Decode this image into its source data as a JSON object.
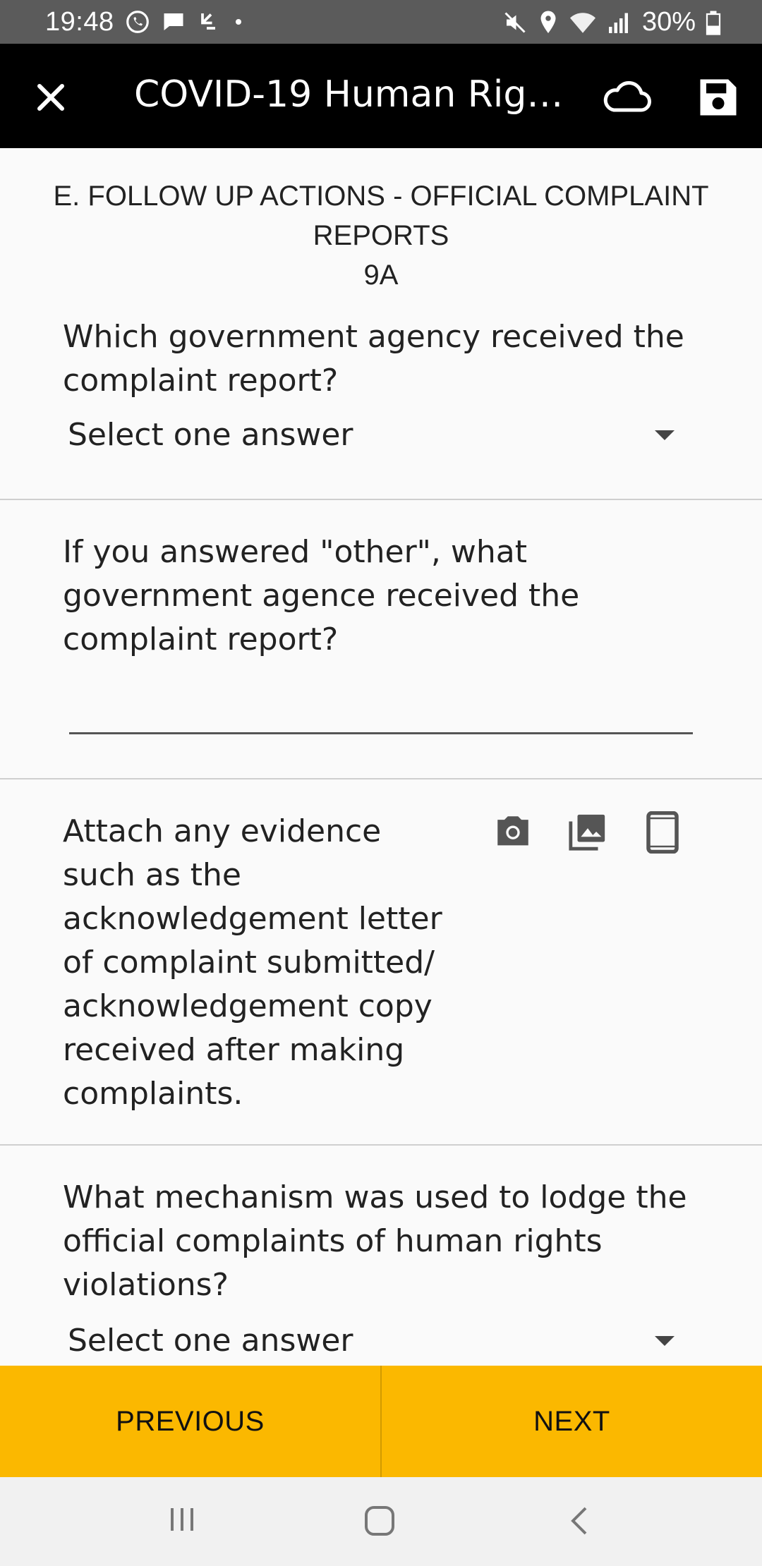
{
  "status_bar": {
    "time": "19:48",
    "battery": "30%",
    "left_icons": [
      "whatsapp-icon",
      "message-icon",
      "missed-call-icon",
      "dot-icon"
    ],
    "right_icons": [
      "mute-icon",
      "location-icon",
      "wifi-icon",
      "signal-icon",
      "battery-icon"
    ]
  },
  "app_bar": {
    "title": "COVID-19 Human Right…",
    "icons": [
      "close-icon",
      "cloud-icon",
      "save-icon"
    ]
  },
  "form": {
    "section_title_line1": "E. FOLLOW UP ACTIONS - OFFICIAL COMPLAINT REPORTS",
    "section_title_line2": "9A",
    "q1": {
      "label": "Which government agency received the complaint report?",
      "select_value": "Select one answer"
    },
    "q2": {
      "label": "If you answered \"other\", what government agence received the complaint report?",
      "input_value": ""
    },
    "q3": {
      "label": "Attach any evidence such as the acknowledgement letter of complaint submitted/ acknowledgement copy received after making complaints.",
      "icons": [
        "camera-icon",
        "gallery-icon",
        "phone-icon"
      ]
    },
    "q4": {
      "label": "What mechanism was used to lodge the official complaints of human rights violations?",
      "select_value": "Select one answer"
    }
  },
  "nav": {
    "previous_label": "PREVIOUS",
    "next_label": "NEXT"
  },
  "colors": {
    "app_bar": "#000000",
    "status_bar": "#5b5b5b",
    "accent": "#fbb800",
    "background": "#fafafa"
  }
}
